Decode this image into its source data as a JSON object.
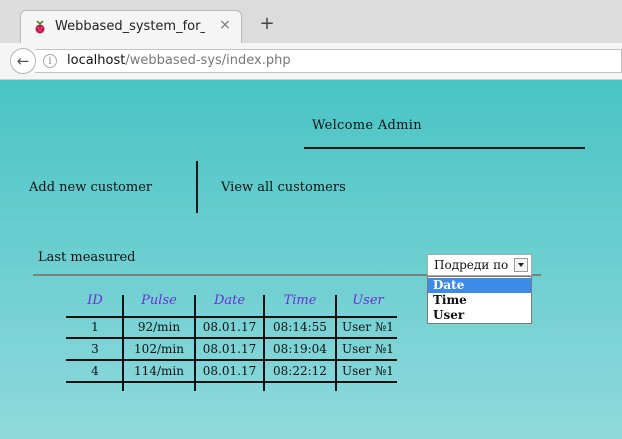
{
  "browser": {
    "tab_title": "Webbased_system_for_meas",
    "tab_close": "×",
    "new_tab": "+",
    "url_host": "localhost",
    "url_path": "/webbased-sys/index.php"
  },
  "page": {
    "welcome": "Welcome Admin",
    "nav": {
      "add_customer": "Add new customer",
      "view_customers": "View all customers"
    },
    "section_title": "Last measured",
    "sort": {
      "selected": "Подреди по",
      "options": [
        "Date",
        "Time",
        "User"
      ],
      "highlighted": "Date"
    },
    "table": {
      "headers": [
        "ID",
        "Pulse",
        "Date",
        "Time",
        "User"
      ],
      "rows": [
        [
          "1",
          "92/min",
          "08.01.17",
          "08:14:55",
          "User №1"
        ],
        [
          "3",
          "102/min",
          "08.01.17",
          "08:19:04",
          "User №1"
        ],
        [
          "4",
          "114/min",
          "08.01.17",
          "08:22:12",
          "User №1"
        ]
      ]
    },
    "colors": {
      "background_top": "#4ac4c4",
      "background_bottom": "#8fd9dc",
      "header_text": "#6a2fd1",
      "dropdown_highlight": "#3d8be6"
    }
  }
}
